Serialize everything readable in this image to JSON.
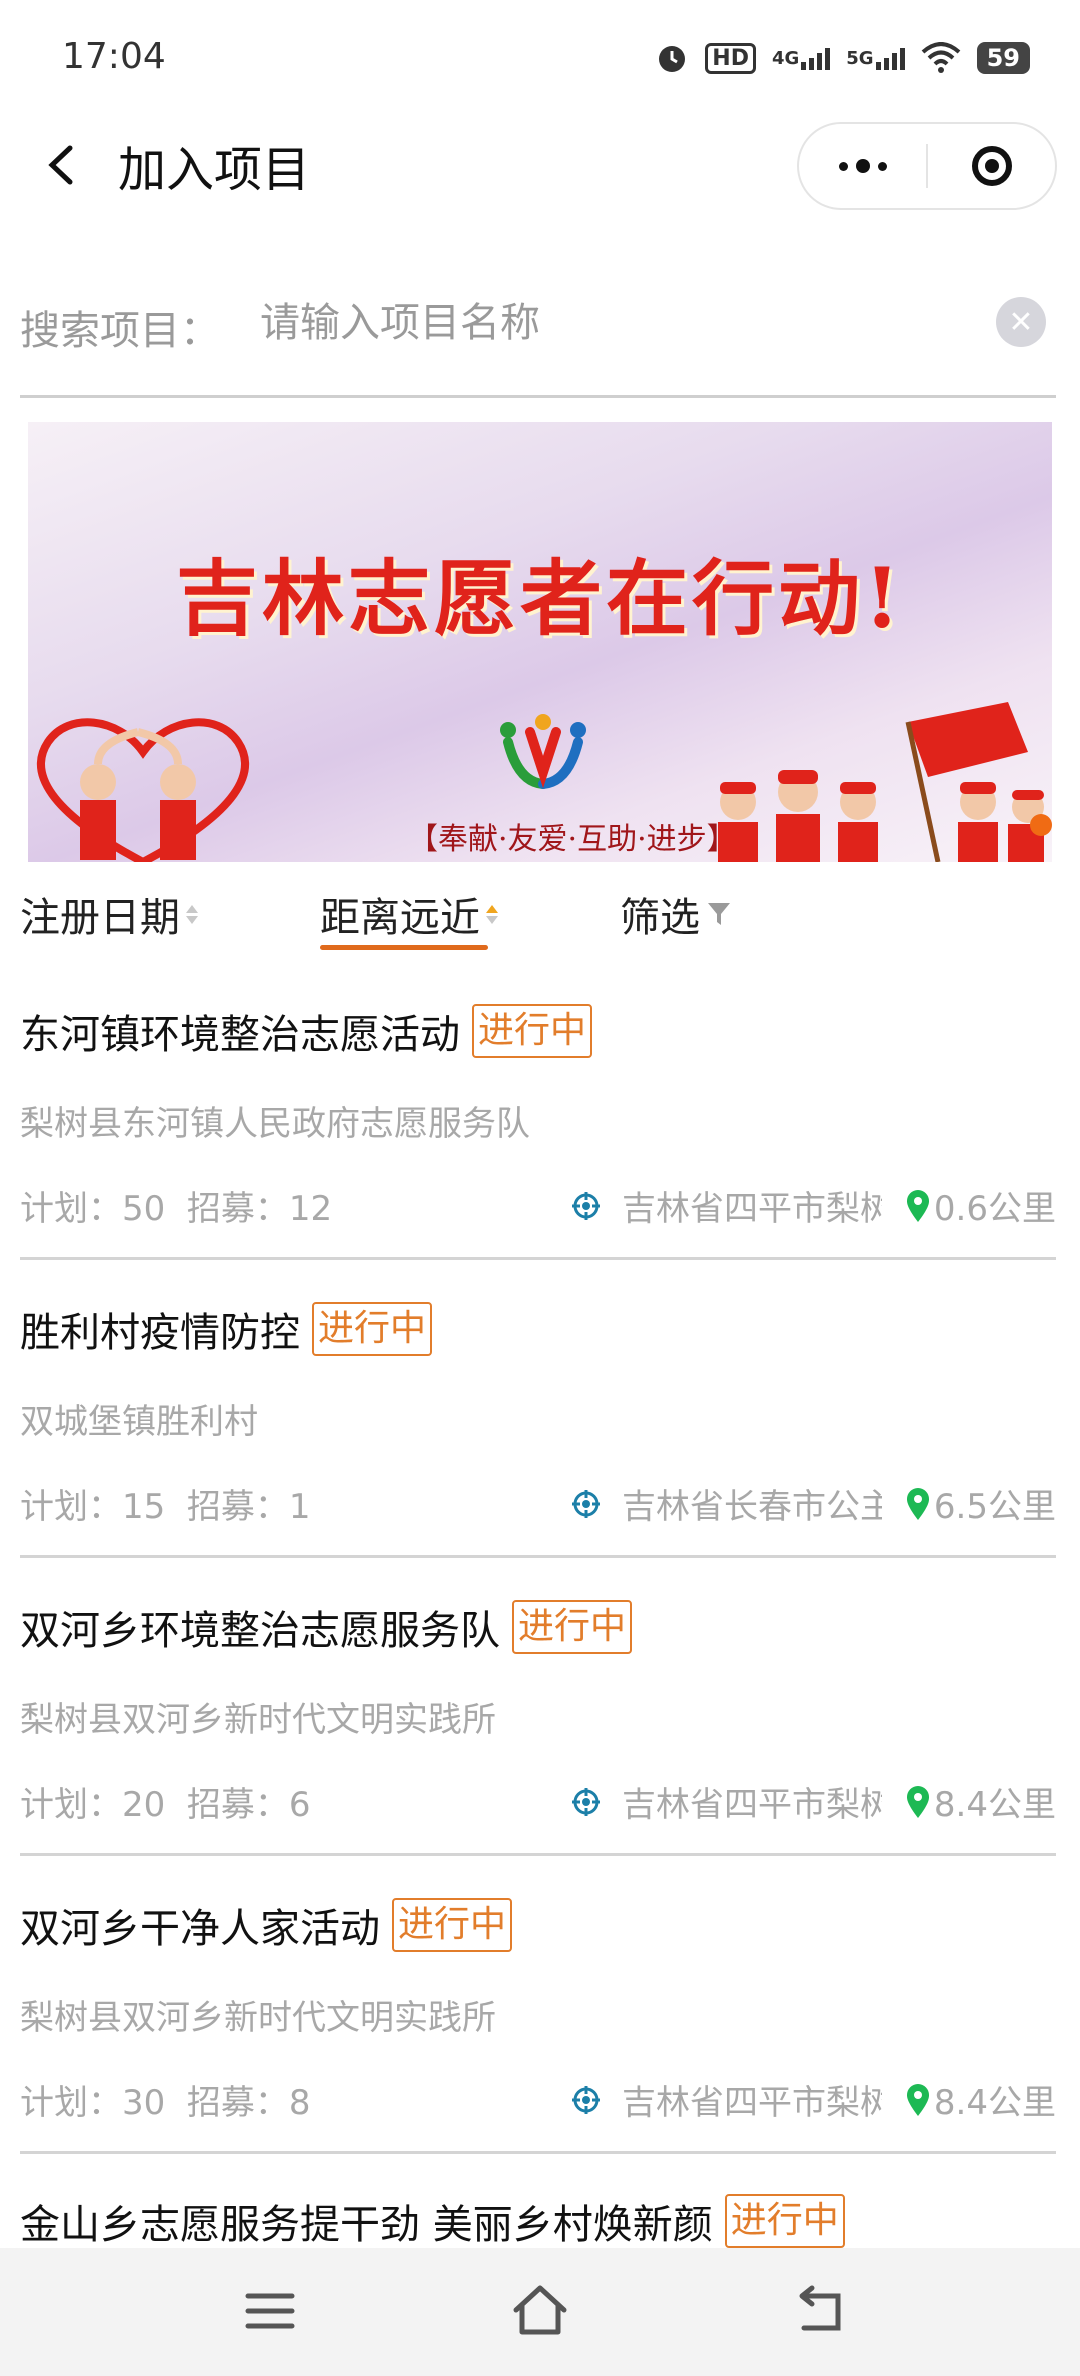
{
  "status_bar": {
    "time": "17:04",
    "hd_label": "HD",
    "network_1": "4G",
    "network_2": "5G",
    "battery": "59",
    "icons": [
      "alarm-icon",
      "hd-icon",
      "signal-4g-icon",
      "signal-5g-icon",
      "wifi-icon",
      "battery-icon"
    ]
  },
  "nav": {
    "title": "加入项目",
    "back_icon": "chevron-left-icon",
    "more_icon": "more-dots-icon",
    "close_icon": "target-close-icon"
  },
  "search": {
    "label": "搜索项目：",
    "placeholder": "请输入项目名称",
    "value": "",
    "clear_icon": "clear-icon"
  },
  "banner": {
    "title": "吉林志愿者在行动!",
    "slogan": "【奉献·友爱·互助·进步】"
  },
  "sort_tabs": [
    {
      "label": "注册日期",
      "icon": "sort-arrows-icon",
      "active": false
    },
    {
      "label": "距离远近",
      "icon": "sort-arrows-icon",
      "active": true
    },
    {
      "label": "筛选",
      "icon": "filter-icon",
      "active": false
    }
  ],
  "projects": [
    {
      "title": "东河镇环境整治志愿活动",
      "status": "进行中",
      "org": "梨树县东河镇人民政府志愿服务队",
      "plan_label": "计划：",
      "plan": "50",
      "recruit_label": "招募：",
      "recruit": "12",
      "location": "吉林省四平市梨树",
      "distance": "0.6公里"
    },
    {
      "title": "胜利村疫情防控",
      "status": "进行中",
      "org": "双城堡镇胜利村",
      "plan_label": "计划：",
      "plan": "15",
      "recruit_label": "招募：",
      "recruit": "1",
      "location": "吉林省长春市公主",
      "distance": "6.5公里"
    },
    {
      "title": "双河乡环境整治志愿服务队",
      "status": "进行中",
      "org": "梨树县双河乡新时代文明实践所",
      "plan_label": "计划：",
      "plan": "20",
      "recruit_label": "招募：",
      "recruit": "6",
      "location": "吉林省四平市梨树",
      "distance": "8.4公里"
    },
    {
      "title": "双河乡干净人家活动",
      "status": "进行中",
      "org": "梨树县双河乡新时代文明实践所",
      "plan_label": "计划：",
      "plan": "30",
      "recruit_label": "招募：",
      "recruit": "8",
      "location": "吉林省四平市梨树",
      "distance": "8.4公里"
    },
    {
      "title": "金山乡志愿服务提干劲 美丽乡村焕新颜",
      "status": "进行中"
    }
  ],
  "bottom_nav": {
    "icons": [
      "menu-icon",
      "home-icon",
      "back-icon"
    ]
  },
  "colors": {
    "accent": "#e27d2b",
    "underline": "#e06a1c",
    "location_icon": "#1c7fa8",
    "pin": "#1db954",
    "muted_text": "#a8a8a8"
  }
}
